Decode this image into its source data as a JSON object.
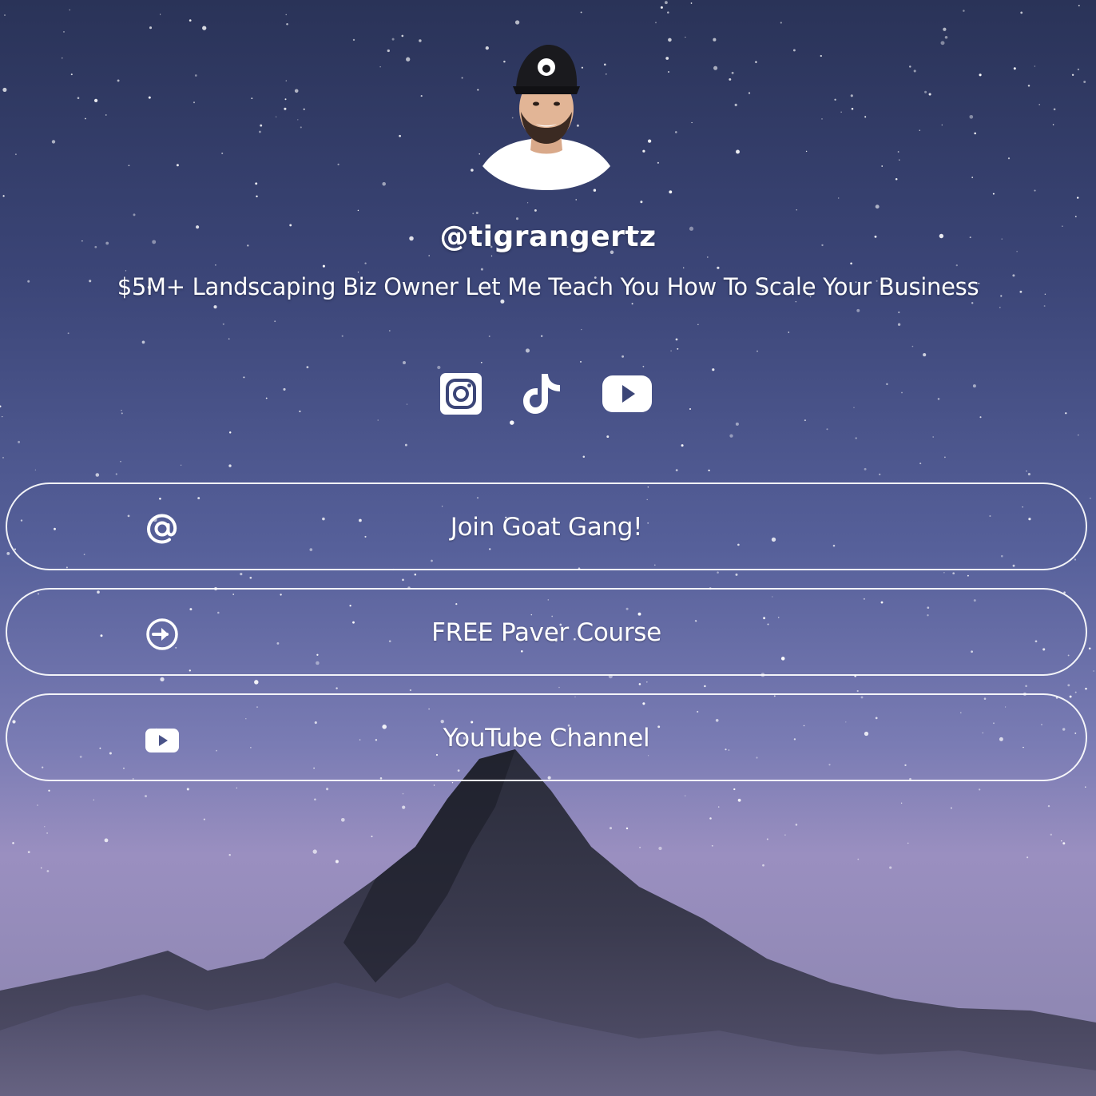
{
  "profile": {
    "handle": "@tigrangertz",
    "bio": "$5M+ Landscaping Biz Owner Let Me Teach You How To Scale Your Business",
    "avatar_icon": "profile-photo"
  },
  "social_links": [
    {
      "name": "instagram",
      "icon": "instagram-icon"
    },
    {
      "name": "tiktok",
      "icon": "tiktok-icon"
    },
    {
      "name": "youtube",
      "icon": "youtube-icon"
    }
  ],
  "link_buttons": [
    {
      "label": "Join Goat Gang!",
      "icon": "at-sign-icon"
    },
    {
      "label": "FREE Paver Course",
      "icon": "arrow-right-circle-icon"
    },
    {
      "label": "YouTube Channel",
      "icon": "youtube-icon"
    }
  ],
  "colors": {
    "text": "#ffffff",
    "sky_top": "#2a3358",
    "sky_mid": "#56609a",
    "sky_bottom": "#9a8fc0",
    "mountain": "#1c1f2c"
  }
}
